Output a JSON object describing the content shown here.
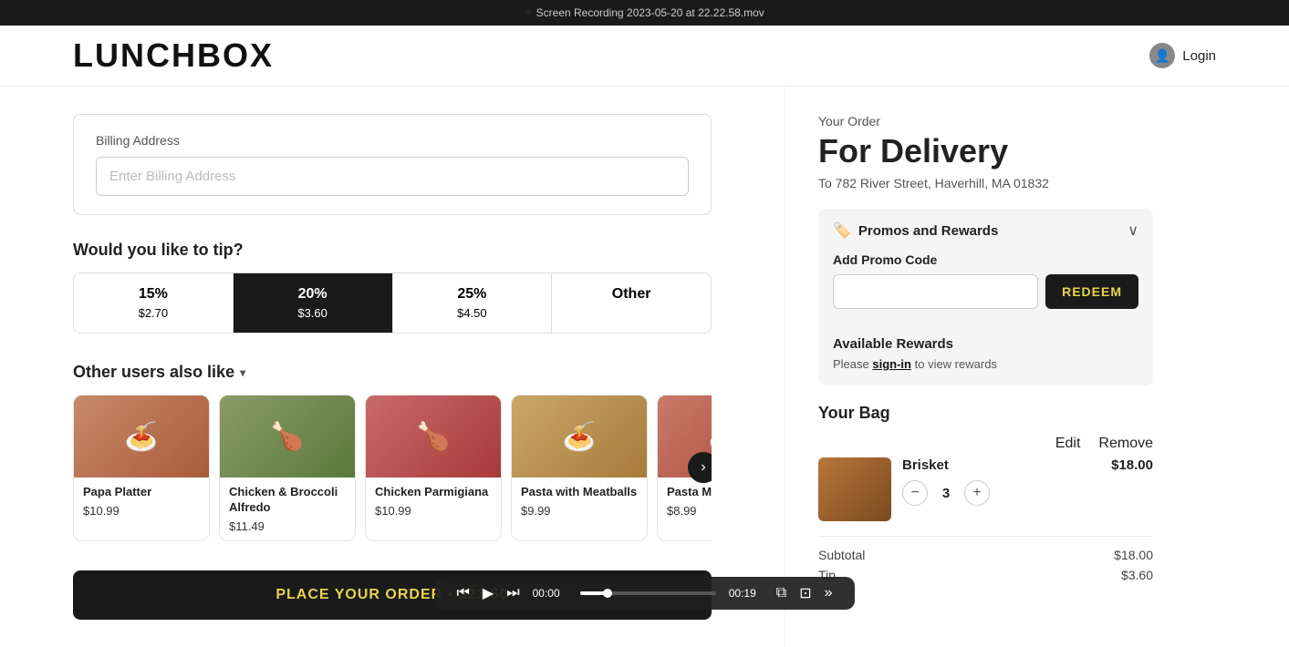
{
  "topBar": {
    "text": "Screen Recording 2023-05-20 at 22.22.58.mov",
    "icon": "⏺"
  },
  "header": {
    "logo": "LUNCHBOX",
    "login": "Login"
  },
  "billing": {
    "label": "Billing Address",
    "placeholder": "Enter Billing Address"
  },
  "tip": {
    "title": "Would you like to tip?",
    "options": [
      {
        "pct": "15%",
        "amt": "$2.70",
        "selected": false
      },
      {
        "pct": "20%",
        "amt": "$3.60",
        "selected": true
      },
      {
        "pct": "25%",
        "amt": "$4.50",
        "selected": false
      },
      {
        "pct": "Other",
        "amt": "",
        "selected": false
      }
    ]
  },
  "alsoLike": {
    "title": "Other users also like",
    "items": [
      {
        "name": "Papa Platter",
        "price": "$10.99",
        "emoji": "🍝"
      },
      {
        "name": "Chicken & Broccoli Alfredo",
        "price": "$11.49",
        "emoji": "🍗"
      },
      {
        "name": "Chicken Parmigiana",
        "price": "$10.99",
        "emoji": "🍗"
      },
      {
        "name": "Pasta with Meatballs",
        "price": "$9.99",
        "emoji": "🍝"
      },
      {
        "name": "Pasta Marinara",
        "price": "$8.99",
        "emoji": "🍝"
      }
    ]
  },
  "placeOrder": {
    "label": "PLACE YOUR ORDER • $21.60"
  },
  "order": {
    "eyebrow": "Your Order",
    "type": "For Delivery",
    "address": "To 782 River Street, Haverhill, MA 01832"
  },
  "promos": {
    "title": "Promos and Rewards",
    "addPromoLabel": "Add Promo Code",
    "promoPlaceholder": "",
    "redeemBtn": "REDEEM",
    "availableRewardsLabel": "Available Rewards",
    "signInText": "Please",
    "signInLink": "sign-in",
    "signInSuffix": "to view rewards"
  },
  "bag": {
    "title": "Your Bag",
    "editLabel": "Edit",
    "removeLabel": "Remove",
    "items": [
      {
        "name": "Brisket",
        "qty": 3,
        "price": "$18.00"
      }
    ],
    "subtotalLabel": "Subtotal",
    "subtotalValue": "$18.00",
    "tipLabel": "Tip",
    "tipValue": "$3.60"
  },
  "videoBar": {
    "currentTime": "00:00",
    "duration": "00:19",
    "progressPct": 20
  }
}
